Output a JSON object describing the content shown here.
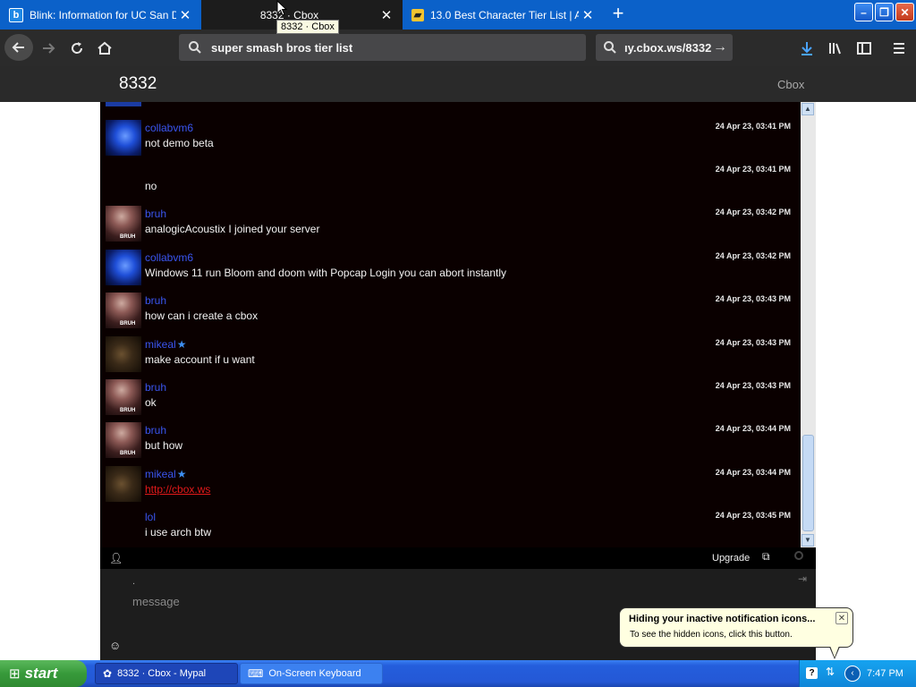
{
  "browser": {
    "tabs": [
      {
        "title": "Blink: Information for UC San Diego",
        "favicon": "b"
      },
      {
        "title": "8332 · Cbox",
        "favicon": ""
      },
      {
        "title": "13.0 Best Character Tier List | Ap",
        "favicon": ""
      }
    ],
    "tooltip": "8332 · Cbox",
    "url_text": "super smash bros tier list",
    "search_text": "ıy.cbox.ws/8332",
    "colors": {
      "tabstrip": "#0b61c9",
      "navbar": "#2b2b2b"
    }
  },
  "page": {
    "title": "8332",
    "brand": "Cbox"
  },
  "chat": {
    "messages": [
      {
        "user": "collabvm6",
        "star": false,
        "avatar": "blue-jellyfish",
        "text": "not demo beta",
        "time": "24 Apr 23, 03:41 PM",
        "link": false
      },
      {
        "user": "",
        "star": false,
        "avatar": "none",
        "text": "no",
        "time": "24 Apr 23, 03:41 PM",
        "link": false
      },
      {
        "user": "bruh",
        "star": false,
        "avatar": "bruh",
        "text": "analogicAcoustix I joined your server",
        "time": "24 Apr 23, 03:42 PM",
        "link": false
      },
      {
        "user": "collabvm6",
        "star": false,
        "avatar": "blue-jellyfish",
        "text": "Windows 11 run Bloom and doom with Popcap Login you can abort instantly",
        "time": "24 Apr 23, 03:42 PM",
        "link": false
      },
      {
        "user": "bruh",
        "star": false,
        "avatar": "bruh",
        "text": "how can i create a cbox",
        "time": "24 Apr 23, 03:43 PM",
        "link": false
      },
      {
        "user": "mikeal",
        "star": true,
        "avatar": "mikeal",
        "text": "make account if u want",
        "time": "24 Apr 23, 03:43 PM",
        "link": false
      },
      {
        "user": "bruh",
        "star": false,
        "avatar": "bruh",
        "text": "ok",
        "time": "24 Apr 23, 03:43 PM",
        "link": false
      },
      {
        "user": "bruh",
        "star": false,
        "avatar": "bruh",
        "text": "but how",
        "time": "24 Apr 23, 03:44 PM",
        "link": false
      },
      {
        "user": "mikeal",
        "star": true,
        "avatar": "mikeal",
        "text": "http://cbox.ws",
        "time": "24 Apr 23, 03:44 PM",
        "link": true
      },
      {
        "user": "lol",
        "star": false,
        "avatar": "none",
        "text": "i use arch btw",
        "time": "24 Apr 23, 03:45 PM",
        "link": false
      }
    ],
    "avatar_caption": "BRUH",
    "upgrade_label": "Upgrade",
    "name_value": ".",
    "message_placeholder": "message",
    "scroll_position": 0.88,
    "colors": {
      "username": "#3a55f0",
      "link": "#e2191a",
      "background": "#0a0000"
    }
  },
  "balloon": {
    "title": "Hiding your inactive notification icons...",
    "text": "To see the hidden icons, click this button."
  },
  "taskbar": {
    "start_label": "start",
    "buttons": [
      {
        "label": "8332 · Cbox - Mypal",
        "icon": "mypal-icon"
      },
      {
        "label": "On-Screen Keyboard",
        "icon": "keyboard-icon"
      }
    ],
    "clock": "7:47 PM"
  }
}
